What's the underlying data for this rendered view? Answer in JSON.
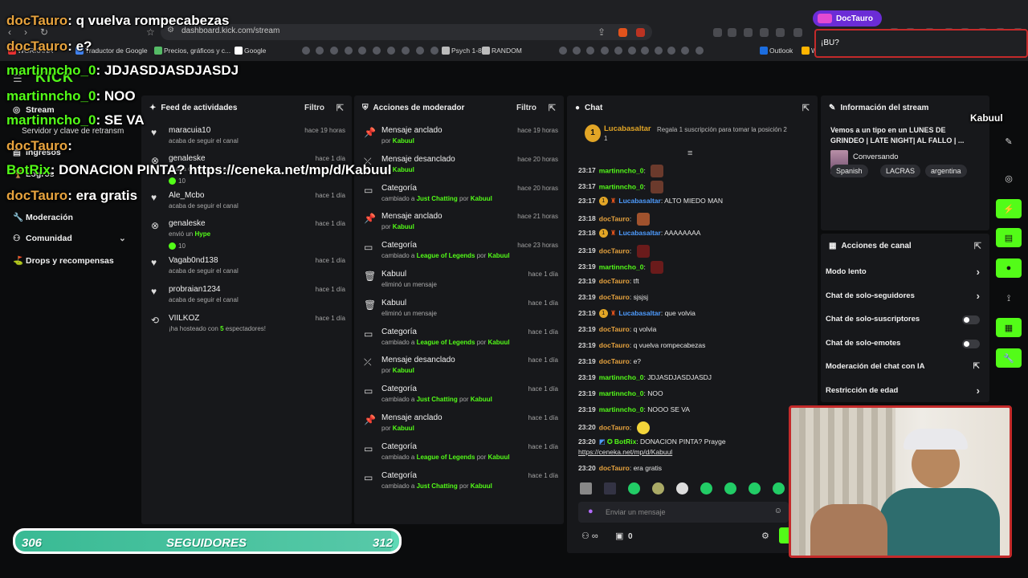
{
  "browser": {
    "url": "dashboard.kick.com/stream",
    "bookmarks": [
      "WORKANA",
      "Traductor de Google",
      "Precios, gráficos y c...",
      "Google",
      "Psych 1-8",
      "RANDOM",
      "Outlook",
      "Weezyx | Interactúa...",
      "Airtm - Get Paid Bet...",
      "ALFREDO"
    ],
    "profile_label": "DocTauro"
  },
  "sidebar": {
    "logo": "KICK",
    "items": [
      {
        "label": "Stream",
        "icon": "broadcast-icon"
      },
      {
        "label": "Servidor y clave de retransm",
        "icon": ""
      },
      {
        "label": "Ingresos",
        "icon": "chart-icon"
      },
      {
        "label": "Logros",
        "icon": "trophy-icon"
      },
      {
        "label": "Moderación",
        "icon": "wrench-icon"
      },
      {
        "label": "Comunidad",
        "icon": "people-icon"
      },
      {
        "label": "Drops y recompensas",
        "icon": "gift-icon"
      }
    ]
  },
  "activity_feed": {
    "title": "Feed de actividades",
    "filter": "Filtro",
    "items": [
      {
        "name": "maracuia10",
        "sub": "acaba de seguir el canal",
        "time": "hace 19 horas",
        "icon": "heart-icon"
      },
      {
        "name": "genaleske",
        "sub": "acaba de seguir el canal",
        "time": "hace 1 día",
        "icon": "kick-icon",
        "extra": "10"
      },
      {
        "name": "Ale_Mcbo",
        "sub": "acaba de seguir el canal",
        "time": "hace 1 día",
        "icon": "heart-icon"
      },
      {
        "name": "genaleske",
        "sub_pre": "envió un",
        "sub_hl": "Hype",
        "time": "hace 1 día",
        "icon": "kick-icon",
        "extra": "10"
      },
      {
        "name": "Vagab0nd138",
        "sub": "acaba de seguir el canal",
        "time": "hace 1 día",
        "icon": "heart-icon"
      },
      {
        "name": "probraian1234",
        "sub": "acaba de seguir el canal",
        "time": "hace 1 día",
        "icon": "heart-icon"
      },
      {
        "name": "VIILKOZ",
        "sub_pre": "¡ha hosteado con",
        "sub_hl": "5",
        "sub_post": "espectadores!",
        "time": "hace 1 día",
        "icon": "host-icon"
      }
    ]
  },
  "mod_actions": {
    "title": "Acciones de moderador",
    "filter": "Filtro",
    "items": [
      {
        "name": "Mensaje anclado",
        "sub_pre": "por",
        "by": "Kabuul",
        "time": "hace 19 horas",
        "icon": "pin-icon"
      },
      {
        "name": "Mensaje desanclado",
        "sub_pre": "por",
        "by": "Kabuul",
        "time": "hace 20 horas",
        "icon": "unpin-icon"
      },
      {
        "name": "Categoría",
        "sub_pre": "cambiado a",
        "cat": "Just Chatting",
        "mid": "por",
        "by": "Kabuul",
        "time": "hace 20 horas",
        "icon": "category-icon"
      },
      {
        "name": "Mensaje anclado",
        "sub_pre": "por",
        "by": "Kabuul",
        "time": "hace 21 horas",
        "icon": "pin-icon"
      },
      {
        "name": "Categoría",
        "sub_pre": "cambiado a",
        "cat": "League of Legends",
        "mid": "por",
        "by": "Kabuul",
        "time": "hace 23 horas",
        "icon": "category-icon"
      },
      {
        "name": "Kabuul",
        "sub_pre": "eliminó un mensaje",
        "time": "hace 1 día",
        "icon": "trash-icon"
      },
      {
        "name": "Kabuul",
        "sub_pre": "eliminó un mensaje",
        "time": "hace 1 día",
        "icon": "trash-icon"
      },
      {
        "name": "Categoría",
        "sub_pre": "cambiado a",
        "cat": "League of Legends",
        "mid": "por",
        "by": "Kabuul",
        "time": "hace 1 día",
        "icon": "category-icon"
      },
      {
        "name": "Mensaje desanclado",
        "sub_pre": "por",
        "by": "Kabuul",
        "time": "hace 1 día",
        "icon": "unpin-icon"
      },
      {
        "name": "Categoría",
        "sub_pre": "cambiado a",
        "cat": "Just Chatting",
        "mid": "por",
        "by": "Kabuul",
        "time": "hace 1 día",
        "icon": "category-icon"
      },
      {
        "name": "Mensaje anclado",
        "sub_pre": "por",
        "by": "Kabuul",
        "time": "hace 1 día",
        "icon": "pin-icon"
      },
      {
        "name": "Categoría",
        "sub_pre": "cambiado a",
        "cat": "League of Legends",
        "mid": "por",
        "by": "Kabuul",
        "time": "hace 1 día",
        "icon": "category-icon"
      },
      {
        "name": "Categoría",
        "sub_pre": "cambiado a",
        "cat": "Just Chatting",
        "mid": "por",
        "by": "Kabuul",
        "time": "hace 1 día",
        "icon": "category-icon"
      }
    ]
  },
  "chat": {
    "title": "Chat",
    "top_gifter": {
      "rank": "1",
      "name": "Lucabasaltar",
      "count": "1",
      "cta": "Regala 1 suscripción para tomar la posición 2"
    },
    "messages": [
      {
        "time": "23:17",
        "user": "martinncho_0",
        "cls": "u-mart",
        "text": "",
        "emote": true
      },
      {
        "time": "23:17",
        "user": "martinncho_0",
        "cls": "u-mart",
        "text": "",
        "emote": true
      },
      {
        "time": "23:17",
        "user": "Lucabasaltar",
        "cls": "u-luca",
        "text": "ALTO MIEDO MAN",
        "badge": true
      },
      {
        "time": "23:18",
        "user": "docTauro",
        "cls": "u-doc",
        "text": "",
        "emote": true
      },
      {
        "time": "23:18",
        "user": "Lucabasaltar",
        "cls": "u-luca",
        "text": "AAAAAAAA",
        "badge": true
      },
      {
        "time": "23:19",
        "user": "docTauro",
        "cls": "u-doc",
        "text": "",
        "emote": true
      },
      {
        "time": "23:19",
        "user": "martinncho_0",
        "cls": "u-mart",
        "text": "",
        "emote": true
      },
      {
        "time": "23:19",
        "user": "docTauro",
        "cls": "u-doc",
        "text": "tft"
      },
      {
        "time": "23:19",
        "user": "docTauro",
        "cls": "u-doc",
        "text": "sjsjsj"
      },
      {
        "time": "23:19",
        "user": "Lucabasaltar",
        "cls": "u-luca",
        "text": "que volvia",
        "badge": true
      },
      {
        "time": "23:19",
        "user": "docTauro",
        "cls": "u-doc",
        "text": "q volvia"
      },
      {
        "time": "23:19",
        "user": "docTauro",
        "cls": "u-doc",
        "text": "q vuelva rompecabezas"
      },
      {
        "time": "23:19",
        "user": "docTauro",
        "cls": "u-doc",
        "text": "e?"
      },
      {
        "time": "23:19",
        "user": "martinncho_0",
        "cls": "u-mart",
        "text": "JDJASDJASDJASDJ"
      },
      {
        "time": "23:19",
        "user": "martinncho_0",
        "cls": "u-mart",
        "text": "NOO"
      },
      {
        "time": "23:19",
        "user": "martinncho_0",
        "cls": "u-mart",
        "text": "NOOO SE VA"
      },
      {
        "time": "23:20",
        "user": "docTauro",
        "cls": "u-doc",
        "text": "",
        "emote": true
      },
      {
        "time": "23:20",
        "user": "BotRix",
        "cls": "u-bot",
        "text": "DONACION PINTA? Prayge"
      },
      {
        "time": "",
        "user": "",
        "cls": "",
        "text": "https://ceneka.net/mp/d/Kabuul",
        "link": true
      },
      {
        "time": "23:20",
        "user": "docTauro",
        "cls": "u-doc",
        "text": "era gratis"
      }
    ],
    "input_placeholder": "Enviar un mensaje",
    "counter": "0"
  },
  "stream_info": {
    "title": "Información del stream",
    "stream_title": "Vemos a un tipo en un LUNES DE GRINDEO | LATE NIGHT| AL FALLO | ...",
    "category": "Conversando",
    "tags": [
      "Spanish",
      "LACRAS",
      "argentina"
    ]
  },
  "channel_actions": {
    "title": "Acciones de canal",
    "items": [
      {
        "label": "Modo lento",
        "type": "arrow"
      },
      {
        "label": "Chat de solo-seguidores",
        "type": "arrow"
      },
      {
        "label": "Chat de solo-suscriptores",
        "type": "toggle"
      },
      {
        "label": "Chat de solo-emotes",
        "type": "toggle"
      },
      {
        "label": "Moderación del chat con IA",
        "type": "link"
      },
      {
        "label": "Restricción de edad",
        "type": "arrow"
      }
    ]
  },
  "overlay": {
    "lines": [
      {
        "user": "docTauro",
        "cls": "nd",
        "text": ": q vuelva rompecabezas"
      },
      {
        "user": "docTauro",
        "cls": "nd",
        "text": ": e?"
      },
      {
        "user": "martinncho_0",
        "cls": "n",
        "text": ": JDJASDJASDJASDJ"
      },
      {
        "user": "martinncho_0",
        "cls": "n",
        "text": ": NOO"
      },
      {
        "user": "martinncho_0",
        "cls": "n",
        "text": ": SE VA"
      },
      {
        "user": "docTauro",
        "cls": "nd",
        "text": ":"
      },
      {
        "user": "BotRix",
        "cls": "n",
        "text": ": DONACION PINTA?  https://ceneka.net/mp/d/Kabuul"
      },
      {
        "user": "docTauro",
        "cls": "nd",
        "text": ": era gratis"
      }
    ],
    "streamer_name": "Kabuul",
    "top_question": "¡BU?"
  },
  "followers": {
    "current": "306",
    "label": "SEGUIDORES",
    "goal": "312",
    "progress": 0.98
  },
  "colors": {
    "accent": "#53fc18",
    "panel": "#17181b",
    "bg": "#0b0c0d",
    "highlight": "#c42a2a"
  }
}
